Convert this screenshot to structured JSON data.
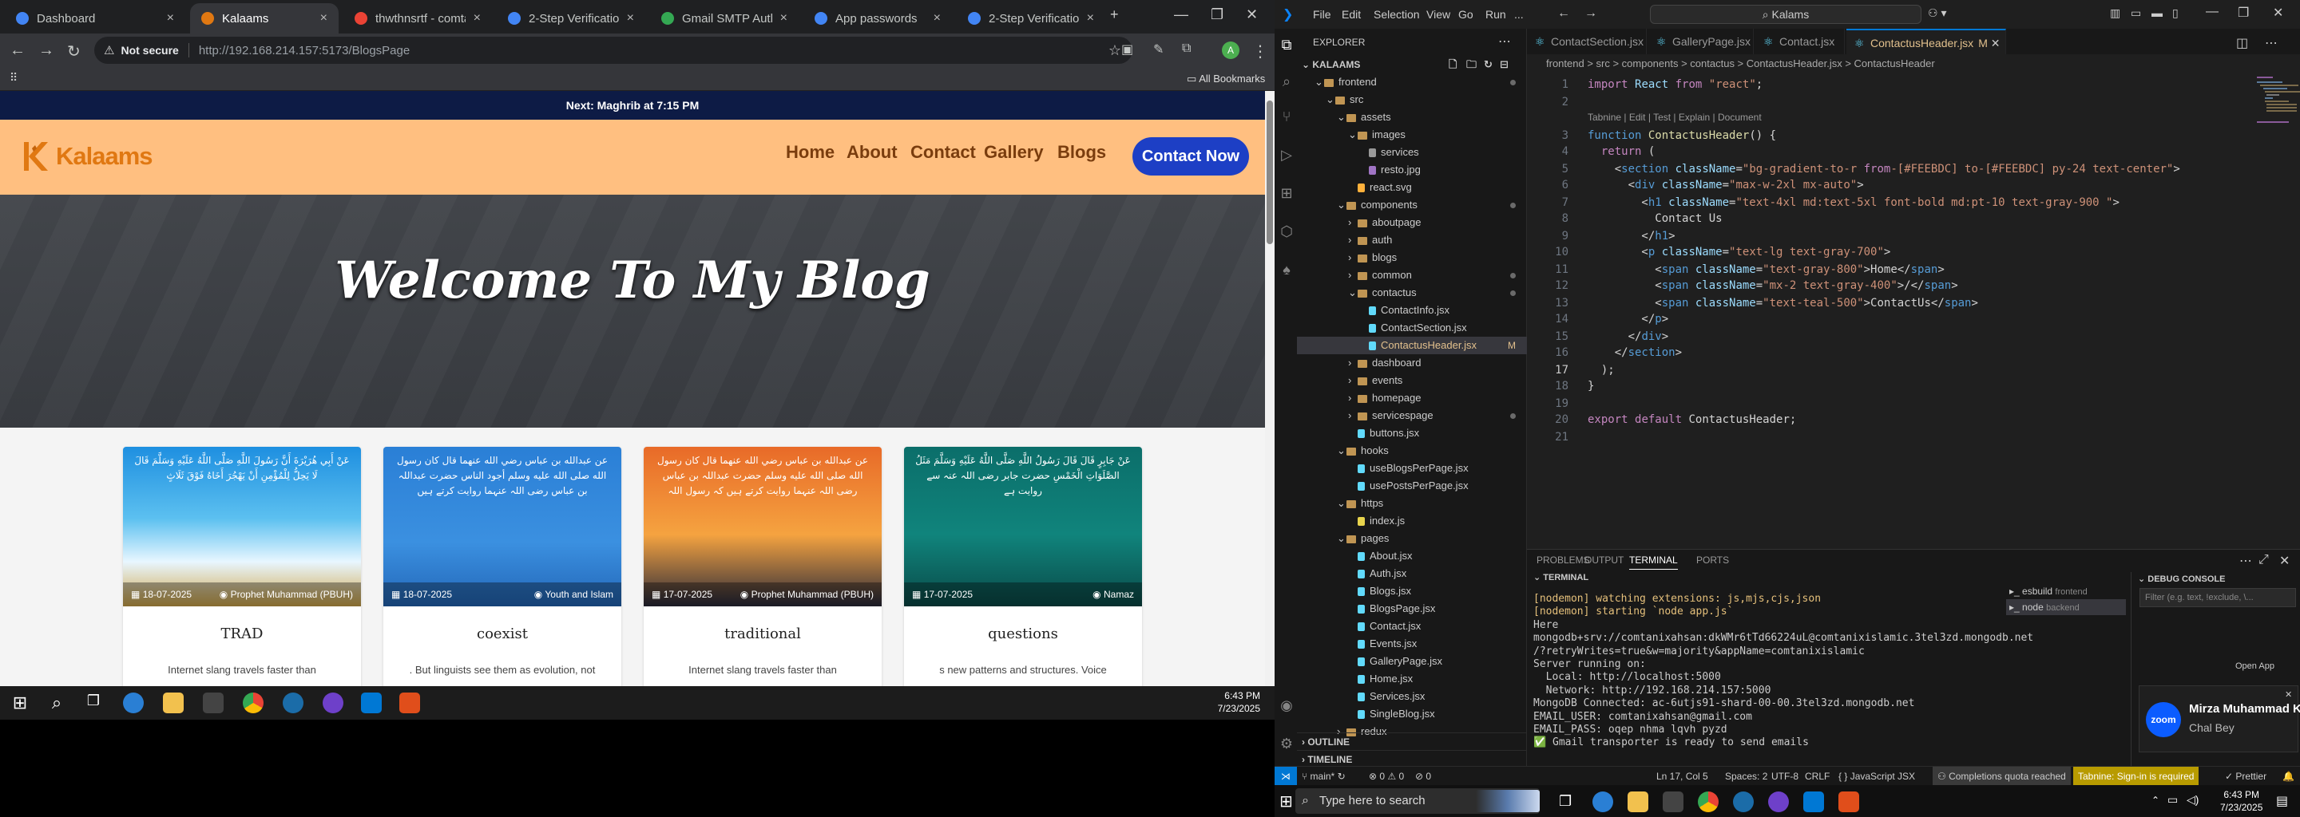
{
  "browser": {
    "tabs": [
      {
        "title": "Dashboard",
        "color": "#4285f4"
      },
      {
        "title": "Kalaams",
        "color": "#e07812"
      },
      {
        "title": "thwthnsrtf - comtanixi...",
        "color": "#ea4335"
      },
      {
        "title": "2-Step Verification",
        "color": "#4285f4"
      },
      {
        "title": "Gmail SMTP Authentic...",
        "color": "#34a853"
      },
      {
        "title": "App passwords",
        "color": "#4285f4"
      },
      {
        "title": "2-Step Verification",
        "color": "#4285f4"
      }
    ],
    "not_secure": "Not secure",
    "url": "http://192.168.214.157:5173/BlogsPage",
    "all_bookmarks": "All Bookmarks"
  },
  "site": {
    "prayer_bar": "Next: Maghrib at 7:15 PM",
    "logo_text": "Kalaams",
    "nav": [
      "Home",
      "About",
      "Contact",
      "Gallery",
      "Blogs"
    ],
    "cta": "Contact Now",
    "hero_title": "Welcome To My Blog",
    "cards": [
      {
        "arabic": "عَنْ أَبِي هُرَيْرَةَ أَنَّ رَسُولَ اللَّهِ صَلَّى اللَّهُ عَلَيْهِ وَسَلَّمَ قَالَ لَا يَحِلُّ لِلْمُؤْمِنِ أَنْ يَهْجُرَ أَخَاهُ فَوْقَ ثَلَاثٍ",
        "date": "18-07-2025",
        "tag": "Prophet Muhammad (PBUH)",
        "title": "TRAD",
        "desc": "Internet slang travels faster than",
        "bg": "sky"
      },
      {
        "arabic": "عن عبدالله بن عباس رضي الله عنهما قال كان رسول الله صلى الله عليه وسلم أجود الناس حضرت عبداللہ بن عباس رضی اللہ عنہما روایت کرتے ہیں",
        "date": "18-07-2025",
        "tag": "Youth and Islam",
        "title": "coexist",
        "desc": ". But linguists see them as evolution, not",
        "bg": "blue"
      },
      {
        "arabic": "عن عبدالله بن عباس رضي الله عنهما قال كان رسول الله صلى الله عليه وسلم حضرت عبداللہ بن عباس رضی اللہ عنہما روایت کرتے ہیں کہ رسول اللہ",
        "date": "17-07-2025",
        "tag": "Prophet Muhammad (PBUH)",
        "title": "traditional",
        "desc": "Internet slang travels faster than",
        "bg": "sunset"
      },
      {
        "arabic": "عَنْ جَابِرٍ قَالَ قَالَ رَسُولُ اللَّهِ صَلَّى اللَّهُ عَلَيْهِ وَسَلَّمَ مَثَلُ الصَّلَوَاتِ الْخَمْسِ حضرت جابر رضی اللہ عنہ سے روایت ہے",
        "date": "17-07-2025",
        "tag": "Namaz",
        "title": "questions",
        "desc": "s new patterns and structures. Voice",
        "bg": "teal"
      }
    ]
  },
  "left_taskbar": {
    "time": "6:43 PM",
    "date": "7/23/2025"
  },
  "vscode": {
    "menu": [
      "File",
      "Edit",
      "Selection",
      "View",
      "Go",
      "Run",
      "..."
    ],
    "search": "Kalams",
    "explorer_title": "EXPLORER",
    "root": "KALAAMS",
    "tree": [
      {
        "label": "frontend",
        "depth": 1,
        "type": "folder-open",
        "dot": true
      },
      {
        "label": "src",
        "depth": 2,
        "type": "folder-open"
      },
      {
        "label": "assets",
        "depth": 3,
        "type": "folder-open"
      },
      {
        "label": "images",
        "depth": 4,
        "type": "folder-open"
      },
      {
        "label": "services",
        "depth": 5,
        "type": "file"
      },
      {
        "label": "resto.jpg",
        "depth": 5,
        "type": "img"
      },
      {
        "label": "react.svg",
        "depth": 4,
        "type": "svg"
      },
      {
        "label": "components",
        "depth": 3,
        "type": "folder-open",
        "dot": true
      },
      {
        "label": "aboutpage",
        "depth": 4,
        "type": "folder"
      },
      {
        "label": "auth",
        "depth": 4,
        "type": "folder"
      },
      {
        "label": "blogs",
        "depth": 4,
        "type": "folder"
      },
      {
        "label": "common",
        "depth": 4,
        "type": "folder",
        "dot": true
      },
      {
        "label": "contactus",
        "depth": 4,
        "type": "folder-open",
        "dot": true
      },
      {
        "label": "ContactInfo.jsx",
        "depth": 5,
        "type": "jsx"
      },
      {
        "label": "ContactSection.jsx",
        "depth": 5,
        "type": "jsx"
      },
      {
        "label": "ContactusHeader.jsx",
        "depth": 5,
        "type": "jsx",
        "sel": true,
        "mark": "M"
      },
      {
        "label": "dashboard",
        "depth": 4,
        "type": "folder"
      },
      {
        "label": "events",
        "depth": 4,
        "type": "folder"
      },
      {
        "label": "homepage",
        "depth": 4,
        "type": "folder"
      },
      {
        "label": "servicespage",
        "depth": 4,
        "type": "folder",
        "dot": true
      },
      {
        "label": "buttons.jsx",
        "depth": 4,
        "type": "jsx"
      },
      {
        "label": "hooks",
        "depth": 3,
        "type": "folder-open"
      },
      {
        "label": "useBlogsPerPage.jsx",
        "depth": 4,
        "type": "jsx"
      },
      {
        "label": "usePostsPerPage.jsx",
        "depth": 4,
        "type": "jsx"
      },
      {
        "label": "https",
        "depth": 3,
        "type": "folder-open"
      },
      {
        "label": "index.js",
        "depth": 4,
        "type": "js"
      },
      {
        "label": "pages",
        "depth": 3,
        "type": "folder-open"
      },
      {
        "label": "About.jsx",
        "depth": 4,
        "type": "jsx"
      },
      {
        "label": "Auth.jsx",
        "depth": 4,
        "type": "jsx"
      },
      {
        "label": "Blogs.jsx",
        "depth": 4,
        "type": "jsx"
      },
      {
        "label": "BlogsPage.jsx",
        "depth": 4,
        "type": "jsx"
      },
      {
        "label": "Contact.jsx",
        "depth": 4,
        "type": "jsx"
      },
      {
        "label": "Events.jsx",
        "depth": 4,
        "type": "jsx"
      },
      {
        "label": "GalleryPage.jsx",
        "depth": 4,
        "type": "jsx"
      },
      {
        "label": "Home.jsx",
        "depth": 4,
        "type": "jsx"
      },
      {
        "label": "Services.jsx",
        "depth": 4,
        "type": "jsx"
      },
      {
        "label": "SingleBlog.jsx",
        "depth": 4,
        "type": "jsx"
      },
      {
        "label": "redux",
        "depth": 3,
        "type": "folder"
      }
    ],
    "outline": "OUTLINE",
    "timeline": "TIMELINE",
    "editor_tabs": [
      {
        "label": "ContactSection.jsx"
      },
      {
        "label": "GalleryPage.jsx"
      },
      {
        "label": "Contact.jsx"
      },
      {
        "label": "ContactusHeader.jsx",
        "mark": "M",
        "active": true
      }
    ],
    "breadcrumb": "frontend > src > components > contactus > ContactusHeader.jsx > ContactusHeader",
    "codelens": "Tabnine | Edit | Test | Explain | Document",
    "code": [
      "import React from \"react\";",
      "",
      "function ContactusHeader() {",
      "  return (",
      "    <section className=\"bg-gradient-to-r from-[#FEEBDC] to-[#FEEBDC] py-24 text-center\">",
      "      <div className=\"max-w-2xl mx-auto\">",
      "        <h1 className=\"text-4xl md:text-5xl font-bold md:pt-10 text-gray-900 \">",
      "          Contact Us",
      "        </h1>",
      "        <p className=\"text-lg text-gray-700\">",
      "          <span className=\"text-gray-800\">Home</span>",
      "          <span className=\"mx-2 text-gray-400\">/</span>",
      "          <span className=\"text-teal-500\">ContactUs</span>",
      "        </p>",
      "      </div>",
      "    </section>",
      "  );",
      "}",
      "",
      "export default ContactusHeader;",
      ""
    ],
    "panel_tabs": [
      "PROBLEMS",
      "OUTPUT",
      "TERMINAL",
      "PORTS"
    ],
    "terminal_title": "TERMINAL",
    "terminal": [
      "[nodemon] watching extensions: js,mjs,cjs,json",
      "[nodemon] starting `node app.js`",
      "Here",
      "mongodb+srv://comtanixahsan:dkWMr6tTd66224uL@comtanixislamic.3tel3zd.mongodb.net",
      "/?retryWrites=true&w=majority&appName=comtanixislamic",
      "Server running on:",
      "  Local: http://localhost:5000",
      "  Network: http://192.168.214.157:5000",
      "MongoDB Connected: ac-6utjs91-shard-00-00.3tel3zd.mongodb.net",
      "EMAIL_USER: comtanixahsan@gmail.com",
      "EMAIL_PASS: oqep nhma lqvh pyzd",
      "✅ Gmail transporter is ready to send emails"
    ],
    "terminal_list": [
      {
        "name": "esbuild",
        "sub": "frontend"
      },
      {
        "name": "node",
        "sub": "backend"
      }
    ],
    "debug_title": "DEBUG CONSOLE",
    "debug_filter": "Filter (e.g. text, !exclude, \\...",
    "open_app": "Open App",
    "zoom_name": "Mirza Muhammad Khurram",
    "zoom_msg": "Chal Bey",
    "zoom_logo": "zoom",
    "status": {
      "branch": "main*",
      "errors": "⊗ 0 ⚠ 0",
      "warn_count": "0",
      "position": "Ln 17, Col 5",
      "spaces": "Spaces: 2",
      "encoding": "UTF-8",
      "eol": "CRLF",
      "lang": "JavaScript JSX",
      "quota": "Completions quota reached",
      "tabnine": "Tabnine: Sign-in is required",
      "prettier": "Prettier"
    }
  },
  "right_taskbar": {
    "search": "Type here to search",
    "time": "6:43 PM",
    "date": "7/23/2025"
  }
}
